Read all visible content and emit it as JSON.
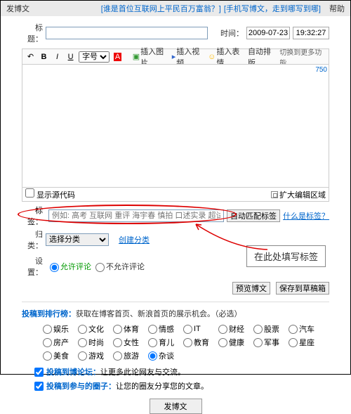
{
  "top": {
    "left": "发博文",
    "link1": "[谁是首位互联网上平民百万富翁？]",
    "link2": "[手机写博文，走到哪写到哪]",
    "help": "帮助"
  },
  "title": {
    "label": "标题：",
    "time_label": "时间：",
    "date": "2009-07-23",
    "time": "19:32:27"
  },
  "tb": {
    "b": "B",
    "i": "I",
    "u": "U",
    "font": "字号",
    "a": "A",
    "img": "插入图片",
    "vid": "插入视频",
    "emo": "插入表情",
    "mov": "自动排版",
    "more": "切换到更多功能"
  },
  "editor": {
    "len": "750",
    "showcode": "显示源代码",
    "expand": "扩大编辑区域"
  },
  "tag": {
    "label": "标签：",
    "ph": "例如: 高考 互联网 重评 海宇春 慎拍 口述实录 超试 老照片",
    "auto": "自动匹配标签",
    "what": "什么是标签？"
  },
  "cls": {
    "label": "归类：",
    "sel": "选择分类",
    "create": "创建分类"
  },
  "set": {
    "label": "设置：",
    "allow": "允许评论",
    "deny": "不允许评论"
  },
  "btns": {
    "preview": "预览博文",
    "draft": "保存到草稿箱"
  },
  "anno": "在此处填写标签",
  "sec1": {
    "t": "投稿到排行榜：",
    "d": "获取在博客首页、新浪首页的展示机会。（必选）"
  },
  "cats": [
    "娱乐",
    "文化",
    "体育",
    "情感",
    "IT",
    "财经",
    "股票",
    "汽车",
    "房产",
    "时尚",
    "女性",
    "育儿",
    "教育",
    "健康",
    "军事",
    "星座",
    "美食",
    "游戏",
    "旅游",
    "杂谈"
  ],
  "chk1": {
    "t": "投稿到博论坛：",
    "d": "让更多此论网友与交流。"
  },
  "chk2": {
    "t": "投稿到参与的圈子：",
    "d": "让您的圈友分享您的文章。"
  },
  "pub": "发博文"
}
